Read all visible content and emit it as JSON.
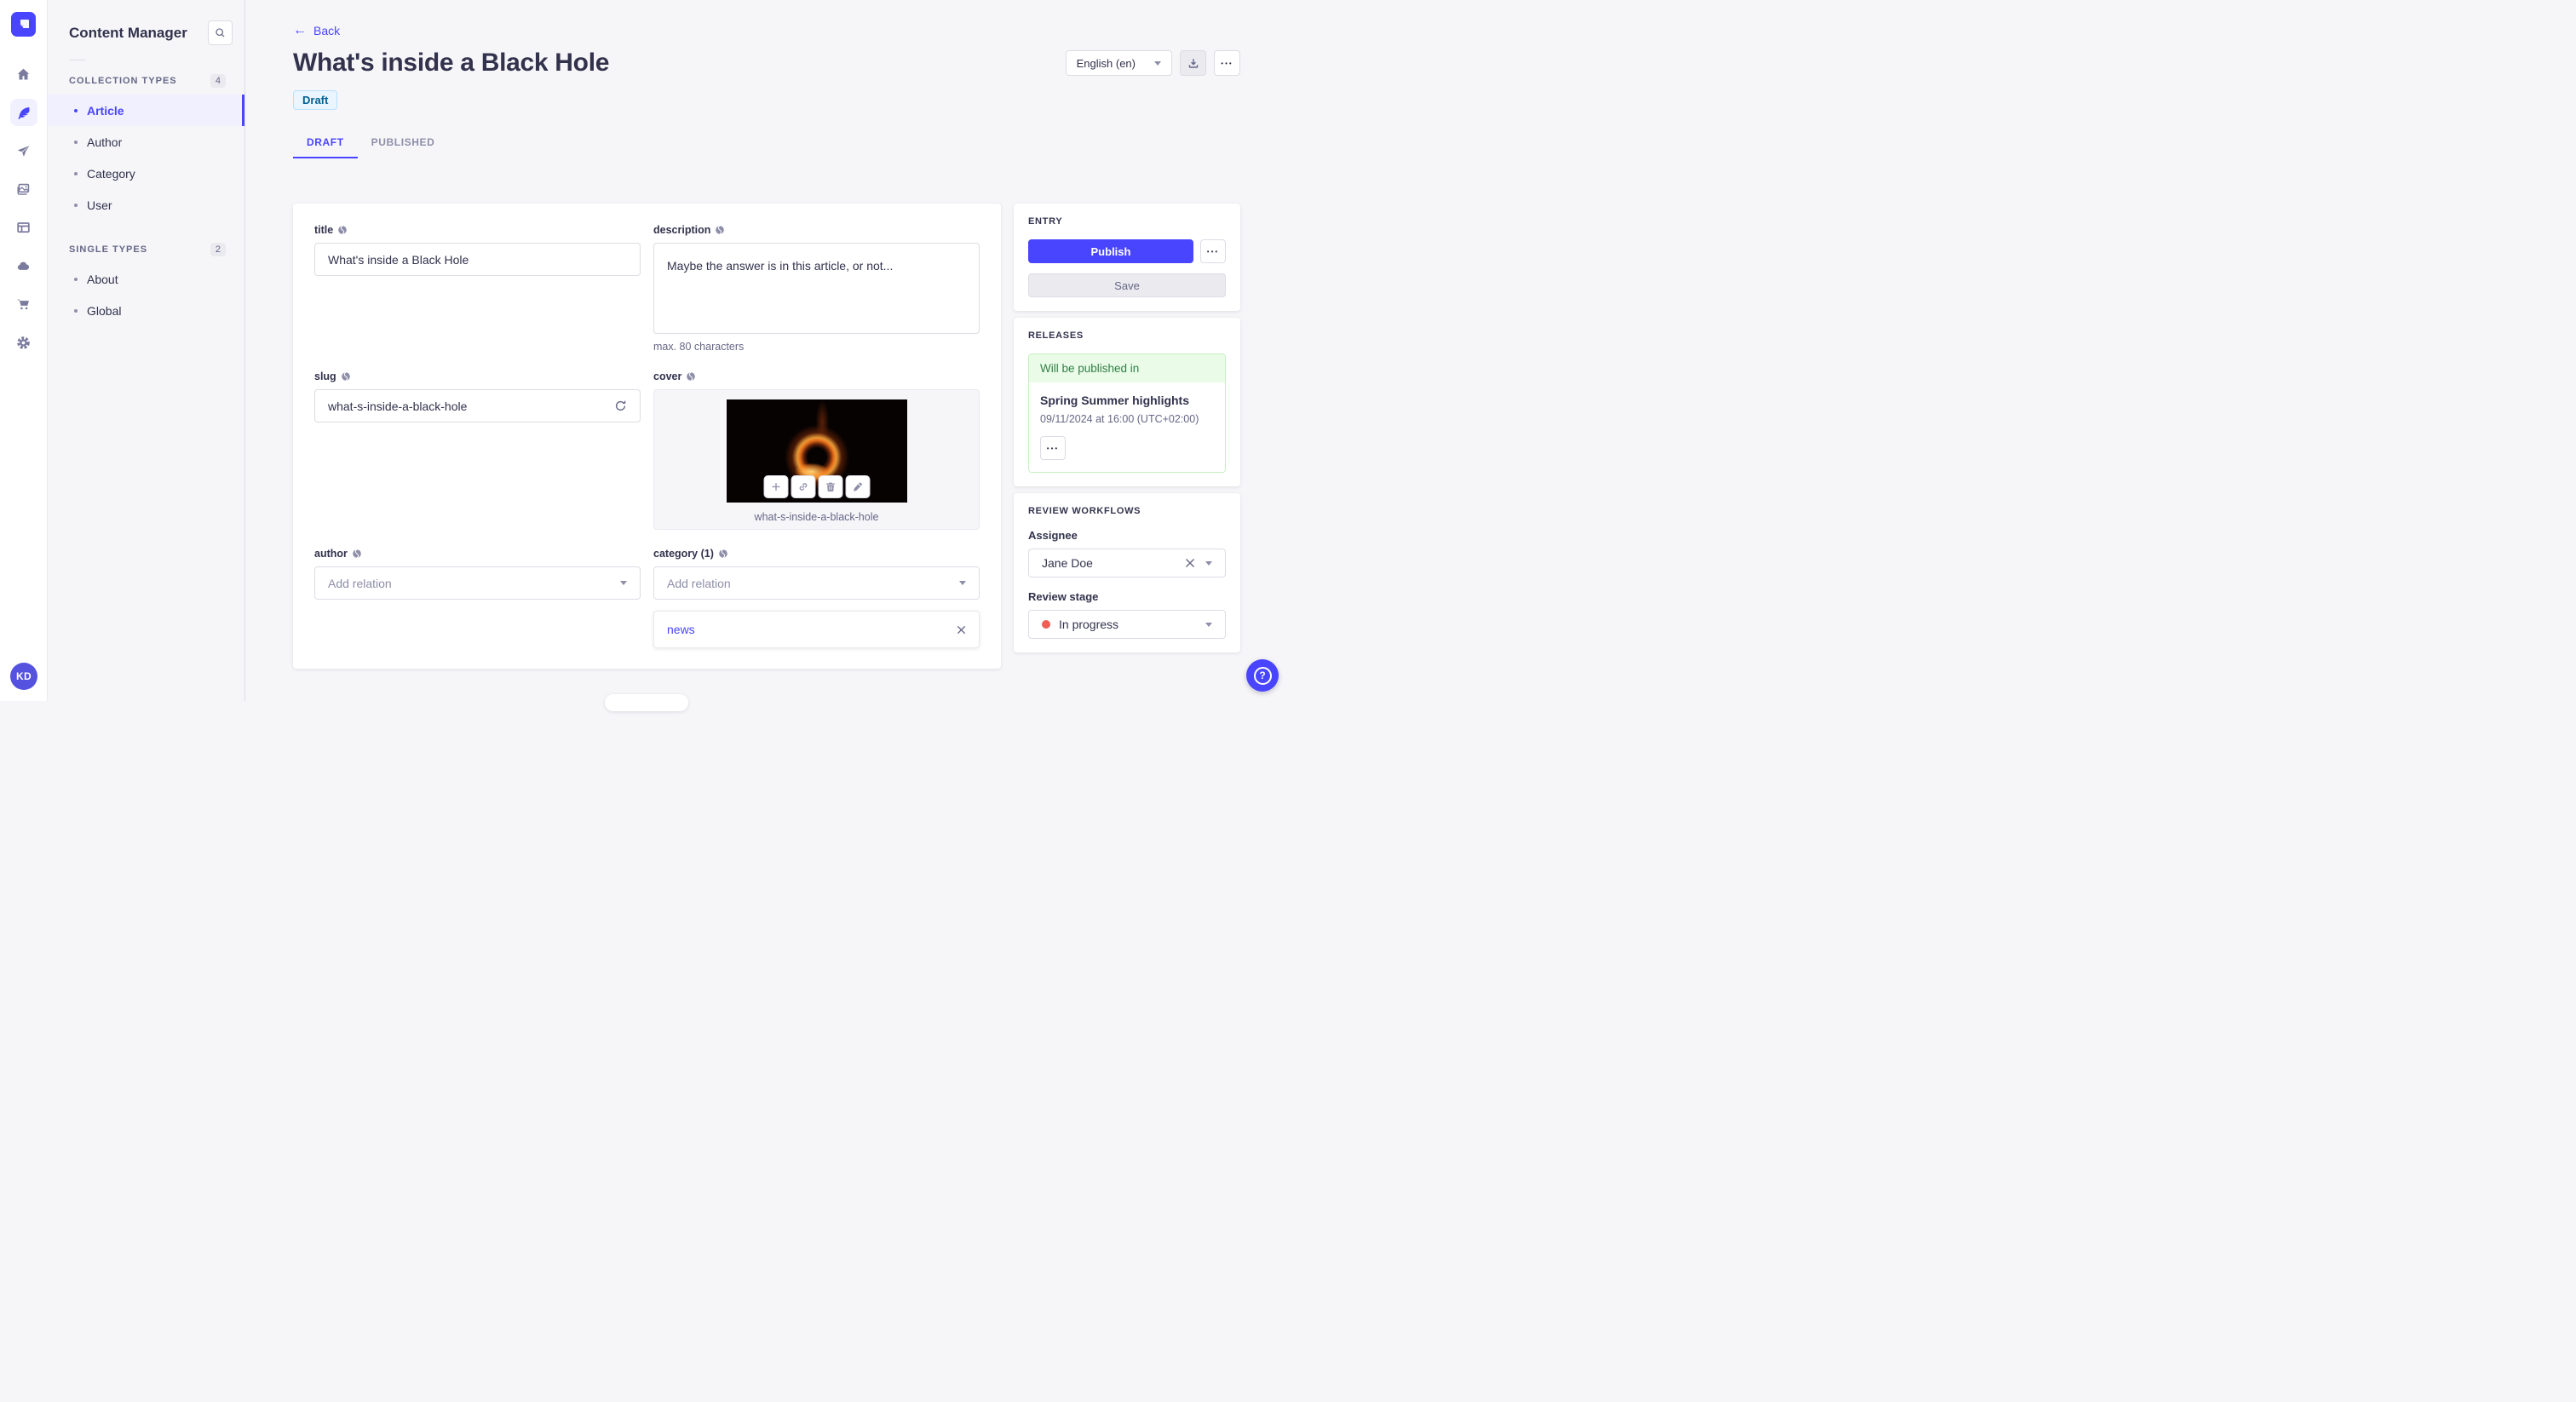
{
  "colors": {
    "primary": "#4945FF",
    "draft_badge_bg": "#EAF5FF",
    "draft_badge_text": "#006096",
    "release_green_bg": "#EAFBE7",
    "release_green_text": "#328048",
    "stage_dot": "#EE5E52"
  },
  "nav_rail": {
    "avatar_initials": "KD"
  },
  "sidebar": {
    "title": "Content Manager",
    "sections": [
      {
        "label": "COLLECTION TYPES",
        "count": "4",
        "items": [
          {
            "label": "Article",
            "active": true
          },
          {
            "label": "Author"
          },
          {
            "label": "Category"
          },
          {
            "label": "User"
          }
        ]
      },
      {
        "label": "SINGLE TYPES",
        "count": "2",
        "items": [
          {
            "label": "About"
          },
          {
            "label": "Global"
          }
        ]
      }
    ]
  },
  "header": {
    "back_label": "Back",
    "title": "What's inside a Black Hole",
    "status_badge": "Draft",
    "locale_selector": "English (en)",
    "more_label": "•••"
  },
  "tabs": [
    {
      "label": "DRAFT",
      "active": true
    },
    {
      "label": "PUBLISHED"
    }
  ],
  "form": {
    "title_field": {
      "label": "title",
      "value": "What's inside a Black Hole"
    },
    "description_field": {
      "label": "description",
      "value": "Maybe the answer is in this article, or not...",
      "hint": "max. 80 characters"
    },
    "slug_field": {
      "label": "slug",
      "value": "what-s-inside-a-black-hole"
    },
    "cover_field": {
      "label": "cover",
      "filename": "what-s-inside-a-black-hole"
    },
    "author_field": {
      "label": "author",
      "placeholder": "Add relation"
    },
    "category_field": {
      "label": "category (1)",
      "placeholder": "Add relation",
      "relation": "news"
    }
  },
  "entry_panel": {
    "title": "ENTRY",
    "publish_label": "Publish",
    "save_label": "Save",
    "more_label": "•••"
  },
  "releases_panel": {
    "title": "RELEASES",
    "status": "Will be published in",
    "release_name": "Spring Summer highlights",
    "release_date": "09/11/2024 at 16:00 (UTC+02:00)",
    "more_label": "•••"
  },
  "review_panel": {
    "title": "REVIEW WORKFLOWS",
    "assignee_label": "Assignee",
    "assignee_value": "Jane Doe",
    "stage_label": "Review stage",
    "stage_value": "In progress"
  }
}
